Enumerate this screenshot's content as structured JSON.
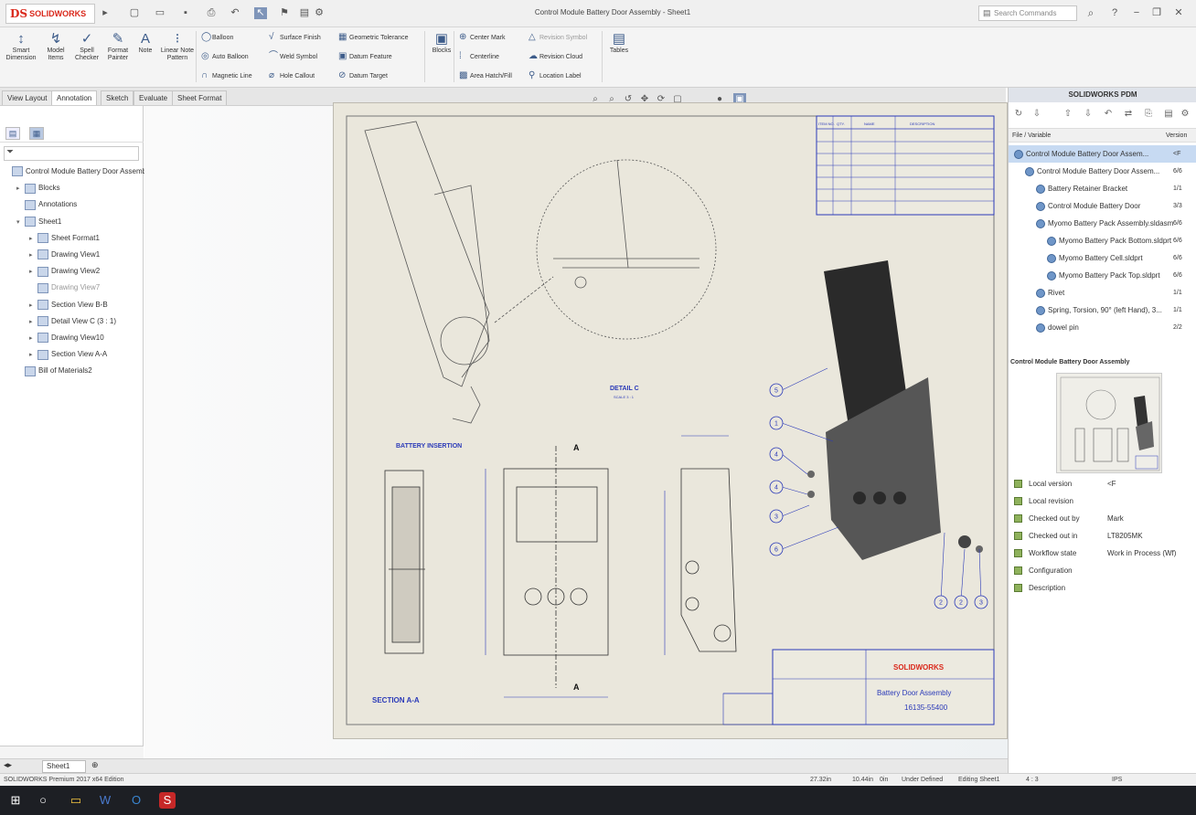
{
  "app": {
    "brand": "SOLIDWORKS",
    "brand_mark": "DS"
  },
  "window": {
    "title": "Control Module Battery Door Assembly - Sheet1"
  },
  "search": {
    "placeholder": "Search Commands"
  },
  "ribbon": {
    "big_buttons": [
      {
        "label": "Smart Dimension",
        "icon": "dimension-icon"
      },
      {
        "label": "Model Items",
        "icon": "model-items-icon"
      },
      {
        "label": "Spell Checker",
        "icon": "spell-check-icon"
      },
      {
        "label": "Format Painter",
        "icon": "format-painter-icon"
      },
      {
        "label": "Note",
        "icon": "note-icon"
      },
      {
        "label": "Linear Note Pattern",
        "icon": "note-pattern-icon"
      }
    ],
    "small_col1": [
      "Balloon",
      "Auto Balloon",
      "Magnetic Line"
    ],
    "small_col2": [
      "Surface Finish",
      "Weld Symbol",
      "Hole Callout"
    ],
    "small_col3": [
      "Geometric Tolerance",
      "Datum Feature",
      "Datum Target"
    ],
    "block_label": "Blocks",
    "small_col4": [
      "Center Mark",
      "Centerline",
      "Area Hatch/Fill"
    ],
    "small_col5": [
      "Revision Symbol",
      "Revision Cloud",
      "Location Label"
    ],
    "tables_label": "Tables"
  },
  "tabs": [
    "View Layout",
    "Annotation",
    "Sketch",
    "Evaluate",
    "Sheet Format"
  ],
  "tree": [
    {
      "label": "Control Module Battery Door Assembl",
      "level": 0,
      "arrow": ""
    },
    {
      "label": "Blocks",
      "level": 1,
      "arrow": "▸"
    },
    {
      "label": "Annotations",
      "level": 1,
      "arrow": ""
    },
    {
      "label": "Sheet1",
      "level": 1,
      "arrow": "▾"
    },
    {
      "label": "Sheet Format1",
      "level": 2,
      "arrow": "▸"
    },
    {
      "label": "Drawing View1",
      "level": 2,
      "arrow": "▸"
    },
    {
      "label": "Drawing View2",
      "level": 2,
      "arrow": "▸"
    },
    {
      "label": "Drawing View7",
      "level": 2,
      "arrow": ""
    },
    {
      "label": "Section View B-B",
      "level": 2,
      "arrow": "▸"
    },
    {
      "label": "Detail View C (3 : 1)",
      "level": 2,
      "arrow": "▸"
    },
    {
      "label": "Drawing View10",
      "level": 2,
      "arrow": "▸"
    },
    {
      "label": "Section View A-A",
      "level": 2,
      "arrow": "▸"
    },
    {
      "label": "Bill of Materials2",
      "level": 1,
      "arrow": ""
    }
  ],
  "drawing": {
    "detail_label": "DETAIL C",
    "detail_scale": "SCALE 3 : 1",
    "battery_label": "BATTERY INSERTION",
    "section_label": "SECTION A-A",
    "section_marker": "A",
    "title_block_company": "SOLIDWORKS",
    "title_block_title": "Battery Door Assembly",
    "title_block_number": "16135-55400",
    "balloons": [
      "5",
      "1",
      "4",
      "4",
      "3",
      "6",
      "2",
      "2",
      "3"
    ],
    "bom_headers": [
      "ITEM NO.",
      "QTY.",
      "NAME",
      "DESCRIPTION"
    ]
  },
  "pdm": {
    "title": "SOLIDWORKS PDM",
    "col_name": "File / Variable",
    "col_version": "Version",
    "rows": [
      {
        "name": "Control Module Battery Door Assem...",
        "version": "<F",
        "indent": 0,
        "selected": true
      },
      {
        "name": "Control Module Battery Door Assem...",
        "version": "6/6",
        "indent": 1,
        "selected": false
      },
      {
        "name": "Battery Retainer Bracket",
        "version": "1/1",
        "indent": 2,
        "selected": false
      },
      {
        "name": "Control Module Battery Door",
        "version": "3/3",
        "indent": 2,
        "selected": false
      },
      {
        "name": "Myomo Battery Pack Assembly.sldasm",
        "version": "6/6",
        "indent": 2,
        "selected": false
      },
      {
        "name": "Myomo Battery Pack Bottom.sldprt",
        "version": "6/6",
        "indent": 3,
        "selected": false
      },
      {
        "name": "Myomo Battery Cell.sldprt",
        "version": "6/6",
        "indent": 3,
        "selected": false
      },
      {
        "name": "Myomo Battery Pack Top.sldprt",
        "version": "6/6",
        "indent": 3,
        "selected": false
      },
      {
        "name": "Rivet",
        "version": "1/1",
        "indent": 2,
        "selected": false
      },
      {
        "name": "Spring, Torsion, 90° (left Hand), 3...",
        "version": "1/1",
        "indent": 2,
        "selected": false
      },
      {
        "name": "dowel pin",
        "version": "2/2",
        "indent": 2,
        "selected": false
      }
    ],
    "preview_title": "Control Module Battery Door Assembly",
    "props": [
      {
        "key": "Local version",
        "value": "<F"
      },
      {
        "key": "Local revision",
        "value": ""
      },
      {
        "key": "Checked out by",
        "value": "Mark"
      },
      {
        "key": "Checked out in",
        "value": "LT8205MK"
      },
      {
        "key": "Workflow state",
        "value": "Work in Process (Wf)"
      },
      {
        "key": "Configuration",
        "value": ""
      },
      {
        "key": "Description",
        "value": ""
      }
    ]
  },
  "sheet_tab": "Sheet1",
  "status": {
    "edition": "SOLIDWORKS Premium 2017 x64 Edition",
    "x": "27.32in",
    "y": "10.44in",
    "z": "0in",
    "state": "Under Defined",
    "editing": "Editing Sheet1",
    "scale": "4 : 3",
    "units": "IPS"
  },
  "colors": {
    "brand": "#da291c",
    "blue_annotation": "#2b3ab8",
    "sheet": "#eae7dc"
  }
}
